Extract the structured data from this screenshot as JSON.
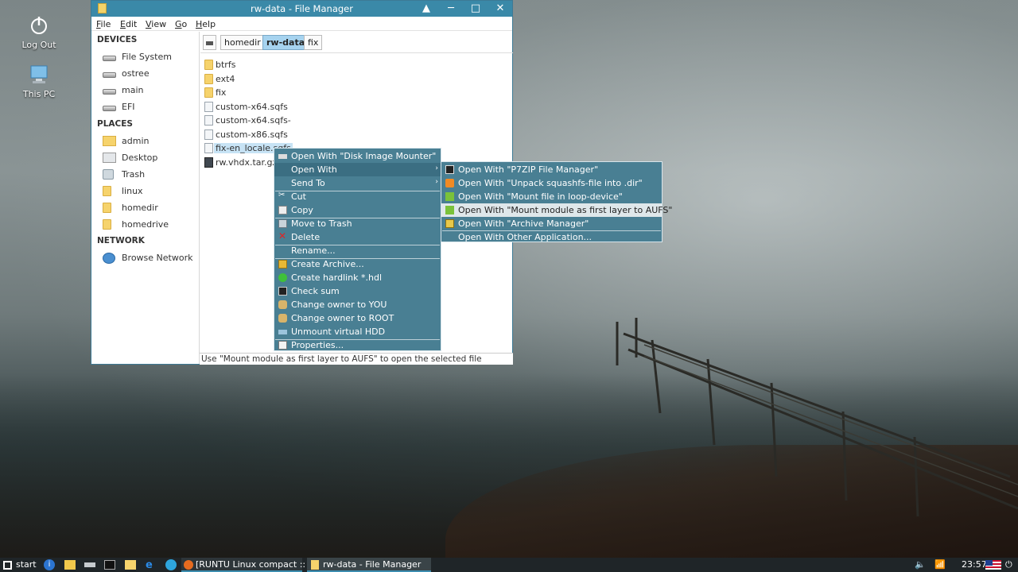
{
  "desktop": {
    "icons": [
      {
        "label": "Log Out",
        "icon": "power-icon"
      },
      {
        "label": "This PC",
        "icon": "computer-icon"
      }
    ]
  },
  "window": {
    "title": "rw-data - File Manager",
    "controls": {
      "up": "▲",
      "minimize": "─",
      "maximize": "□",
      "close": "✕"
    }
  },
  "menubar": {
    "items": [
      "File",
      "Edit",
      "View",
      "Go",
      "Help"
    ]
  },
  "sidebar": {
    "devices_header": "DEVICES",
    "devices": [
      "File System",
      "ostree",
      "main",
      "EFI"
    ],
    "places_header": "PLACES",
    "places": [
      "admin",
      "Desktop",
      "Trash",
      "linux",
      "homedir",
      "homedrive"
    ],
    "network_header": "NETWORK",
    "network": [
      "Browse Network"
    ]
  },
  "pathbar": {
    "crumbs": [
      "homedir",
      "rw-data",
      "fix"
    ],
    "active": "rw-data"
  },
  "files": [
    {
      "name": "btrfs",
      "type": "folder"
    },
    {
      "name": "ext4",
      "type": "folder"
    },
    {
      "name": "fix",
      "type": "folder"
    },
    {
      "name": "custom-x64.sqfs",
      "type": "file"
    },
    {
      "name": "custom-x64.sqfs-",
      "type": "file"
    },
    {
      "name": "custom-x86.sqfs",
      "type": "file"
    },
    {
      "name": "fix-en_locale.sqfs",
      "type": "file",
      "selected": true
    },
    {
      "name": "rw.vhdx.tar.gz",
      "type": "archive"
    }
  ],
  "status": "Use \"Mount module as first layer to AUFS\" to open the selected file",
  "context_menu": {
    "items": [
      {
        "label": "Open With \"Disk Image Mounter\"",
        "icon": "disk-icon"
      },
      {
        "label": "Open With",
        "submenu": true,
        "highlighted": true
      },
      {
        "label": "Send To",
        "submenu": true
      },
      {
        "label": "Cut",
        "icon": "scissors-icon"
      },
      {
        "label": "Copy",
        "icon": "copy-icon"
      },
      {
        "label": "Move to Trash",
        "icon": "trash-icon"
      },
      {
        "label": "Delete",
        "icon": "delete-icon"
      },
      {
        "label": "Rename..."
      },
      {
        "label": "Create Archive...",
        "icon": "archive-icon"
      },
      {
        "label": "Create hardlink *.hdl",
        "icon": "link-icon"
      },
      {
        "label": "Check sum",
        "icon": "terminal-icon"
      },
      {
        "label": "Change owner to YOU",
        "icon": "users-icon"
      },
      {
        "label": "Change owner to ROOT",
        "icon": "users-icon"
      },
      {
        "label": "Unmount virtual HDD",
        "icon": "eject-icon"
      },
      {
        "label": "Properties...",
        "icon": "properties-icon"
      }
    ]
  },
  "submenu": {
    "items": [
      {
        "label": "Open With \"P7ZIP File Manager\"",
        "icon": "p7zip-icon"
      },
      {
        "label": "Open With \"Unpack squashfs-file into .dir\"",
        "icon": "unpack-icon"
      },
      {
        "label": "Open With \"Mount file in loop-device\"",
        "icon": "mount-icon"
      },
      {
        "label": "Open With \"Mount module as first layer to AUFS\"",
        "icon": "aufs-icon",
        "selected": true
      },
      {
        "label": "Open With \"Archive Manager\"",
        "icon": "archive-manager-icon"
      },
      {
        "label": "Open With Other Application..."
      }
    ]
  },
  "taskbar": {
    "start_label": "start",
    "tasks": [
      {
        "label": "[RUNTU Linux compact :: ..."
      },
      {
        "label": "rw-data - File Manager",
        "active": true
      }
    ],
    "clock": "23:57"
  },
  "colors": {
    "titlebar": "#3a89a8",
    "menu_bg": "#497f93",
    "menu_highlight": "#3b6e82",
    "selection": "#a6d3ef",
    "taskbar": "#1f2528"
  }
}
